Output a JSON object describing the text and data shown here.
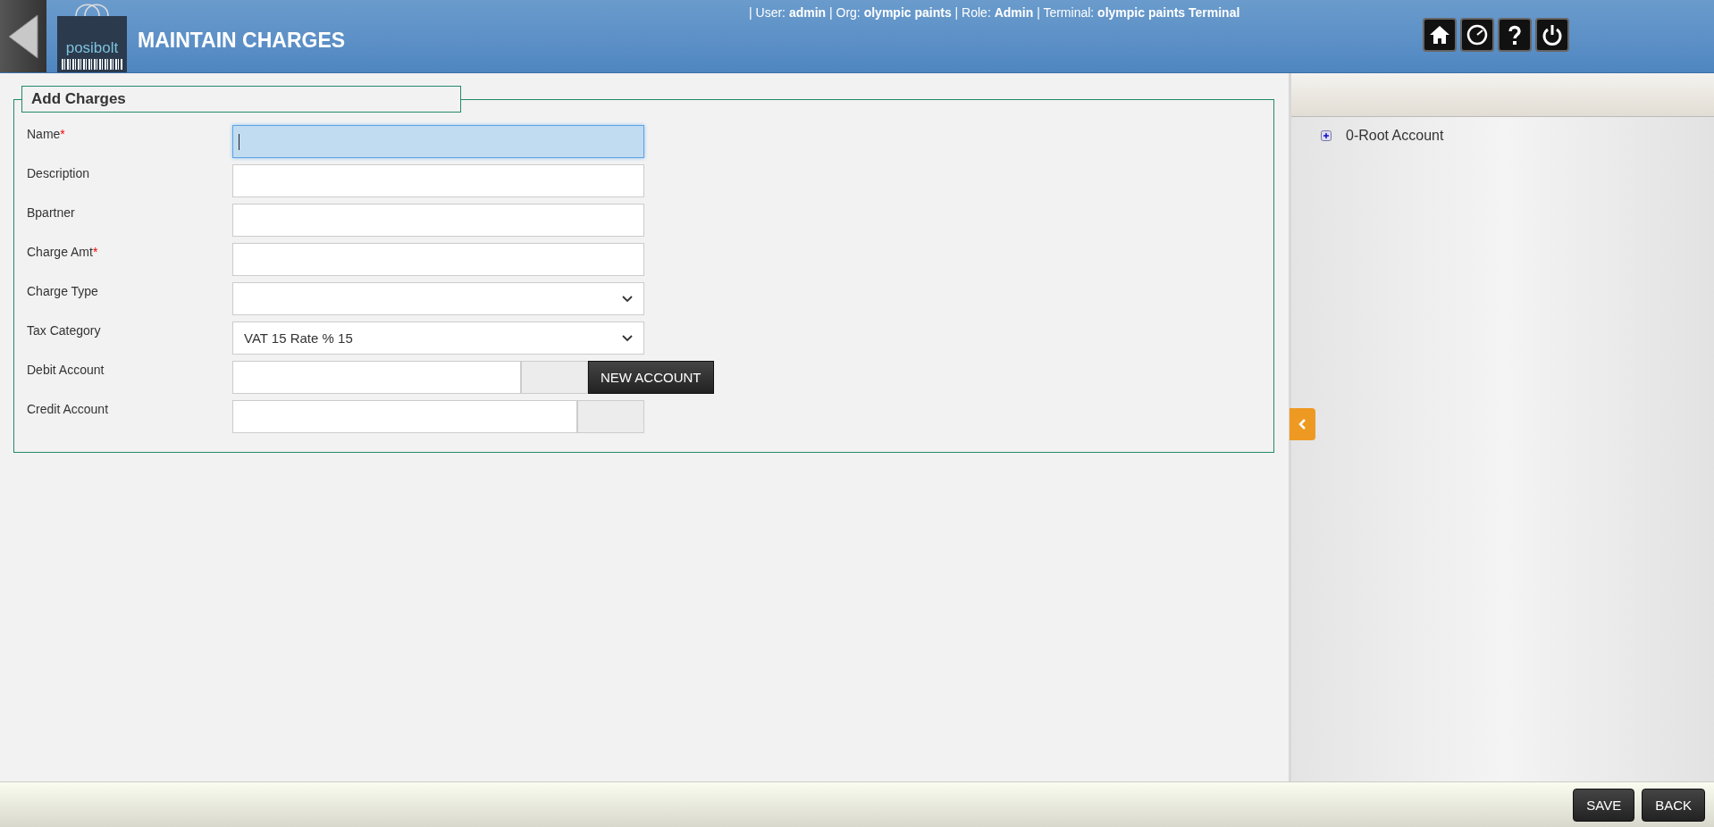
{
  "header": {
    "title": "MAINTAIN CHARGES",
    "logo_text": "posibolt",
    "session_info": "| User: **admin** | Org: **olympic paints** | Role: **Admin** | Terminal: **olympic paints Terminal**"
  },
  "form": {
    "legend": "Add Charges",
    "fields": [
      {
        "label": "Name",
        "required_mark": "*",
        "kind": "text",
        "focused": true
      },
      {
        "label": "Description",
        "kind": "text",
        "focused": false
      },
      {
        "label": "Bpartner",
        "kind": "text",
        "focused": false
      },
      {
        "label": "Charge Amt",
        "required_mark": "*",
        "kind": "text",
        "focused": false
      },
      {
        "label": "Charge Type",
        "kind": "select",
        "focused": false
      },
      {
        "label": "Tax Category",
        "kind": "select",
        "value": "VAT 15 Rate % 15",
        "focused": false
      },
      {
        "label": "Debit Account",
        "kind": "account",
        "button": "NEW ACCOUNT",
        "focused": false
      },
      {
        "label": "Credit Account",
        "kind": "account",
        "focused": false
      }
    ]
  },
  "tree": {
    "items": [
      {
        "label": "0-Root Account",
        "expanded": false
      }
    ]
  },
  "footer": {
    "buttons": [
      "SAVE",
      "BACK"
    ]
  }
}
